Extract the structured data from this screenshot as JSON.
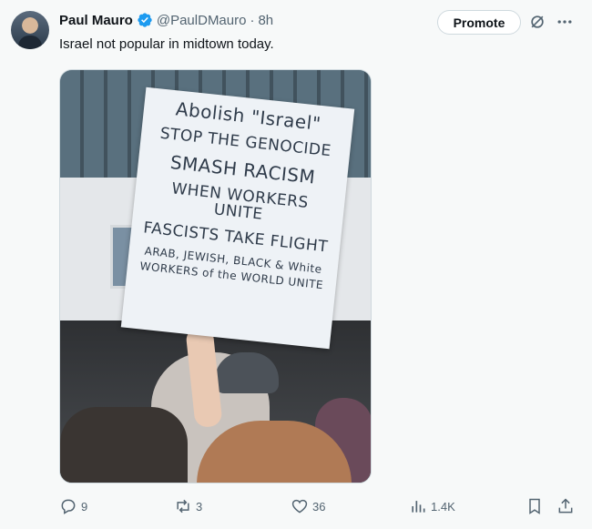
{
  "tweet": {
    "display_name": "Paul Mauro",
    "handle": "@PaulDMauro",
    "separator": "·",
    "time": "8h",
    "text": "Israel not popular in midtown today."
  },
  "header_actions": {
    "promote_label": "Promote"
  },
  "media": {
    "sign_lines": [
      "Abolish \"Israel\"",
      "STOP THE GENOCIDE",
      "SMASH RACISM",
      "WHEN WORKERS UNITE",
      "FASCISTS TAKE FLIGHT",
      "ARAB, JEWISH, BLACK & White",
      "WORKERS of the WORLD UNITE"
    ]
  },
  "actions": {
    "replies": "9",
    "reposts": "3",
    "likes": "36",
    "views": "1.4K"
  },
  "colors": {
    "verified": "#1d9bf0",
    "text_secondary": "#536471",
    "border": "#cfd9de"
  },
  "icons": [
    "verified-badge-icon",
    "grok-icon",
    "more-icon",
    "reply-icon",
    "repost-icon",
    "like-icon",
    "views-icon",
    "bookmark-icon",
    "share-icon"
  ]
}
